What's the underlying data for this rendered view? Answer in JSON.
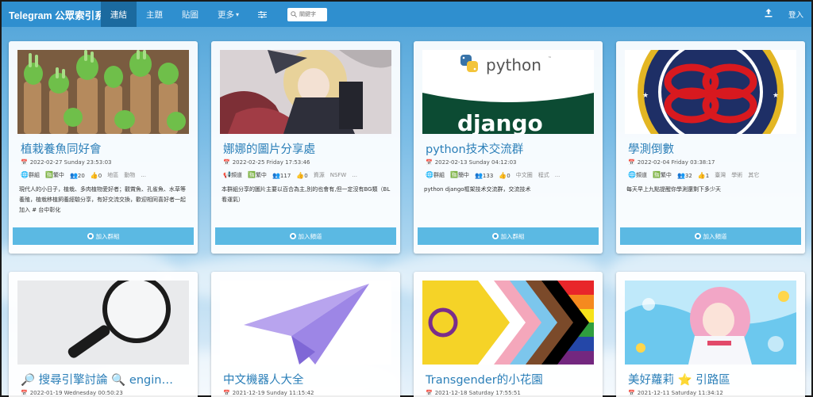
{
  "navbar": {
    "brand": "Telegram 公眾索引系統",
    "items": [
      {
        "label": "連結",
        "active": true
      },
      {
        "label": "主題",
        "active": false
      },
      {
        "label": "貼圖",
        "active": false
      },
      {
        "label": "更多",
        "active": false,
        "caret": "▾"
      }
    ],
    "settings_icon": "sliders-icon",
    "search_placeholder": "關鍵字",
    "upload_icon": "upload-icon",
    "login_label": "登入"
  },
  "cards": [
    {
      "title": "植栽養魚同好會",
      "date": "2022-02-27 Sunday 23:53:03",
      "type": "群組",
      "lang": "繁中",
      "members": "20",
      "likes": "0",
      "tags": [
        "地區",
        "動物",
        "..."
      ],
      "desc": "現代人的小日子，植栽、多肉植物愛好者；觀賞魚、孔雀魚、水草等養殖，植栽移植飼養經驗分享，有好交流交換，歡迎相同喜好者一起加入 # 台中彰化",
      "join_label": "加入群組"
    },
    {
      "title": "娜娜的圖片分享處",
      "date": "2022-02-25 Friday 17:53:46",
      "type": "頻道",
      "lang": "繁中",
      "members": "117",
      "likes": "0",
      "tags": [
        "資源",
        "NSFW",
        "..."
      ],
      "desc": "本群組分享的圖片主要以百合為主,別的也會有,但一定沒有BG類（BL看運氣）",
      "join_label": "加入頻道"
    },
    {
      "title": "python技术交流群",
      "date": "2022-02-13 Sunday 04:12:03",
      "type": "群組",
      "lang": "簡中",
      "members": "133",
      "likes": "0",
      "tags": [
        "中文圈",
        "程式",
        "..."
      ],
      "desc": "python django框架技术交流群，交流技术",
      "join_label": "加入群組",
      "logo_text_1": "python",
      "logo_tm": "™",
      "logo_text_2": "django"
    },
    {
      "title": "學測倒數",
      "date": "2022-02-04 Friday 03:38:17",
      "type": "頻道",
      "lang": "繁中",
      "members": "32",
      "likes": "1",
      "tags": [
        "臺灣",
        "學術",
        "其它"
      ],
      "desc": "每天早上九點提醒你學測還剩下多少天",
      "join_label": "加入頻道"
    },
    {
      "title": "🔎 搜尋引擎討論 🔍 engin…",
      "date": "2022-01-19 Wednesday 00:50:23"
    },
    {
      "title": "中文機器人大全",
      "date": "2021-12-19 Sunday 11:15:42"
    },
    {
      "title": "Transgender的小花園",
      "date": "2021-12-18 Saturday 17:55:51"
    },
    {
      "title": "美好蘿莉 ⭐ 引路區",
      "date": "2021-12-11 Saturday 11:34:12"
    }
  ],
  "colors": {
    "navbar": "#2f8fcf",
    "navbar_active": "#1b6a9f",
    "title": "#2b7fb8",
    "join_button": "#5bb9e3"
  }
}
